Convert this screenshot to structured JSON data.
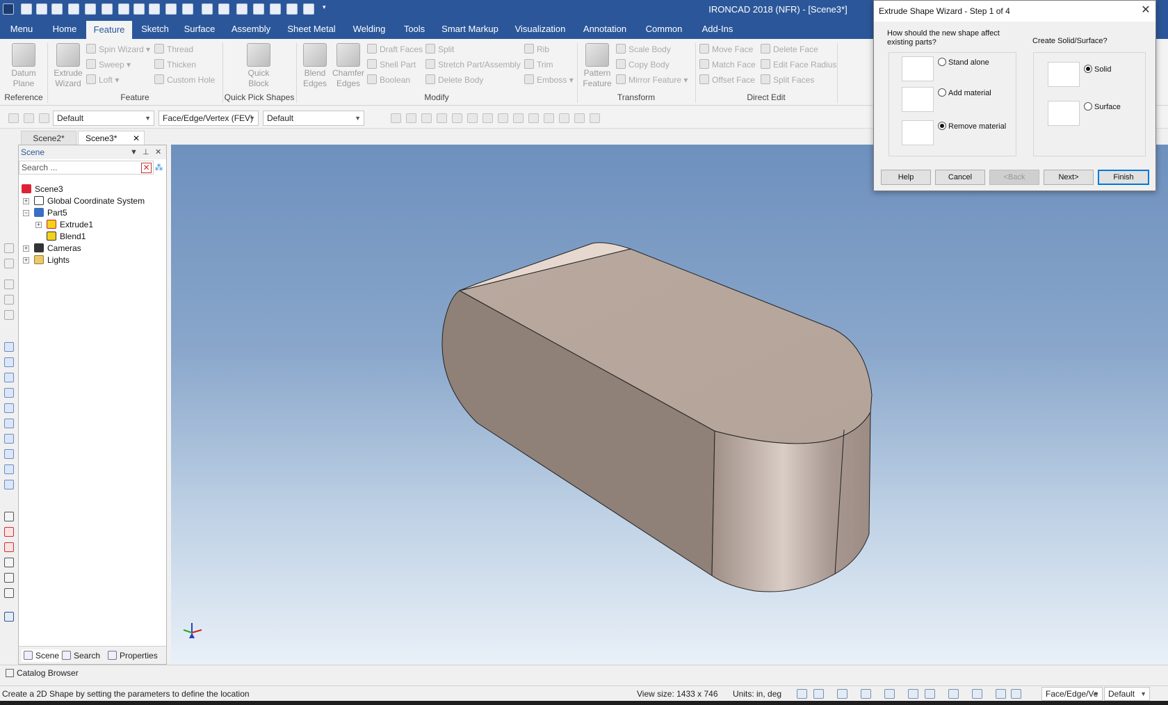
{
  "app": {
    "title": "IRONCAD 2018 (NFR) - [Scene3*]",
    "accent": "#2b579a",
    "window_controls_icon": "collapse-ribbon-chevron-icon"
  },
  "menu": {
    "tabs": [
      "Menu",
      "Home",
      "Feature",
      "Sketch",
      "Surface",
      "Assembly",
      "Sheet Metal",
      "Welding",
      "Tools",
      "Smart Markup",
      "Visualization",
      "Annotation",
      "Common",
      "Add-Ins"
    ],
    "active": "Feature"
  },
  "ribbon": {
    "reference": {
      "datum_label": "Datum\nPlane",
      "group": "Reference"
    },
    "feature": {
      "extrude_label": "Extrude\nWizard",
      "spin": "Spin Wizard",
      "sweep": "Sweep",
      "loft": "Loft",
      "thread": "Thread",
      "thicken": "Thicken",
      "custom_hole": "Custom Hole",
      "group": "Feature"
    },
    "quick": {
      "label": "Quick\nBlock",
      "group": "Quick Pick Shapes"
    },
    "modify": {
      "blend": "Blend\nEdges",
      "chamfer": "Chamfer\nEdges",
      "draft": "Draft Faces",
      "shell": "Shell Part",
      "boolean": "Boolean",
      "split": "Split",
      "stretch": "Stretch Part/Assembly",
      "delete_body": "Delete Body",
      "rib": "Rib",
      "trim": "Trim",
      "emboss": "Emboss",
      "group": "Modify"
    },
    "transform": {
      "pattern": "Pattern\nFeature",
      "scale": "Scale Body",
      "copy": "Copy Body",
      "mirror": "Mirror Feature",
      "group": "Transform"
    },
    "direct": {
      "move": "Move Face",
      "match": "Match Face",
      "offset": "Offset Face",
      "delete": "Delete Face",
      "radius": "Edit Face Radius",
      "splitf": "Split Faces",
      "group": "Direct Edit"
    }
  },
  "toolbar": {
    "combo1": "Default",
    "combo2": "Face/Edge/Vertex (FEV)",
    "combo3": "Default"
  },
  "doc_tabs": {
    "tab1": "Scene2*",
    "tab2": "Scene3*"
  },
  "scene_panel": {
    "title": "Scene",
    "search_placeholder": "Search ...",
    "tree": {
      "root": "Scene3",
      "gcs": "Global Coordinate System",
      "part": "Part5",
      "extrude": "Extrude1",
      "blend": "Blend1",
      "cameras": "Cameras",
      "lights": "Lights"
    },
    "tabs": {
      "scene": "Scene",
      "search": "Search",
      "properties": "Properties"
    }
  },
  "viewport": {
    "bg_top": "#6d90bd",
    "bg_bottom": "#e9f0f8",
    "shape_color": "#b4a49a"
  },
  "catalog": {
    "label": "Catalog Browser"
  },
  "status": {
    "message": "Create a 2D Shape by setting the parameters to define the location",
    "view_size": "View size: 1433 x  746",
    "units": "Units: in, deg",
    "combo1": "Face/Edge/Ve",
    "combo2": "Default"
  },
  "dialog": {
    "title": "Extrude Shape Wizard - Step 1 of 4",
    "question1": "How should the new shape affect\nexisting parts?",
    "question2": "Create Solid/Surface?",
    "options": {
      "stand": "Stand alone",
      "add": "Add material",
      "remove": "Remove material",
      "selected": "remove"
    },
    "type": {
      "solid": "Solid",
      "surface": "Surface",
      "selected": "solid"
    },
    "buttons": {
      "help": "Help",
      "cancel": "Cancel",
      "back": "<Back",
      "next": "Next>",
      "finish": "Finish"
    }
  }
}
